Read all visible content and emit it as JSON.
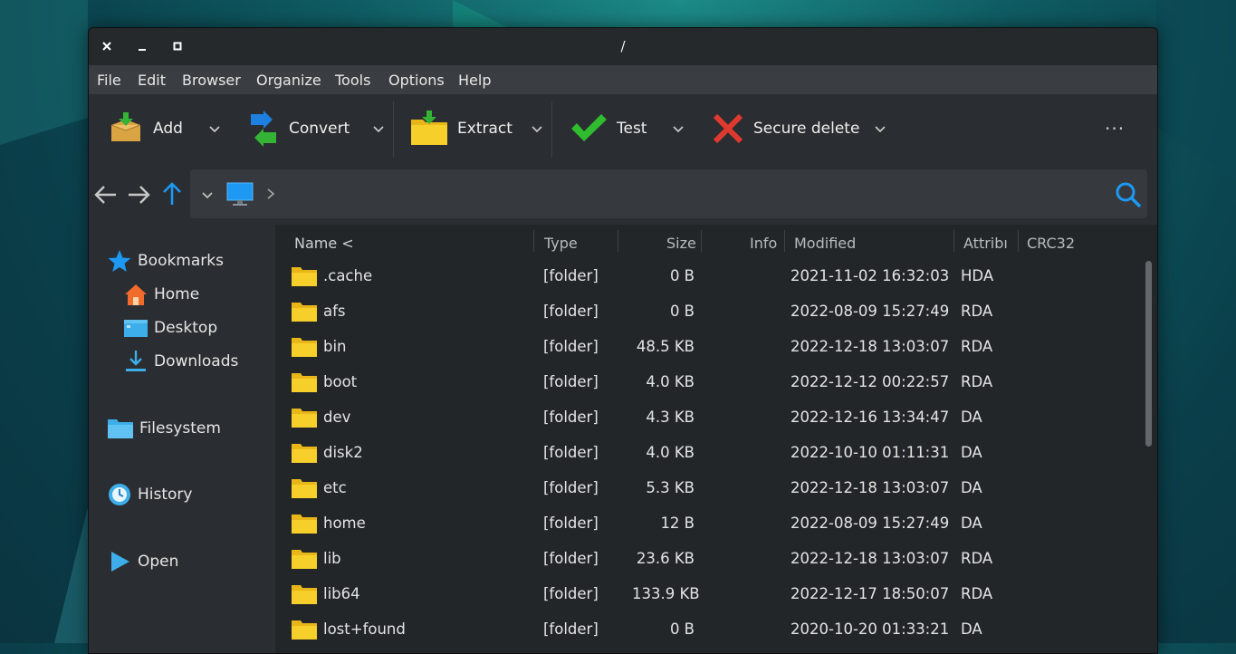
{
  "window": {
    "title": "/"
  },
  "titlebar": {
    "close": "×",
    "minimize": "–",
    "maximize": "▫"
  },
  "menu": [
    "File",
    "Edit",
    "Browser",
    "Organize",
    "Tools",
    "Options",
    "Help"
  ],
  "toolbar": {
    "add": "Add",
    "convert": "Convert",
    "extract": "Extract",
    "test": "Test",
    "secure_delete": "Secure delete",
    "more": "···"
  },
  "sidebar": {
    "bookmarks": "Bookmarks",
    "home": "Home",
    "desktop": "Desktop",
    "downloads": "Downloads",
    "filesystem": "Filesystem",
    "history": "History",
    "open": "Open"
  },
  "columns": {
    "name": "Name <",
    "type": "Type",
    "size": "Size",
    "info": "Info",
    "modified": "Modified",
    "attrib": "Attribı",
    "crc": "CRC32"
  },
  "files": [
    {
      "name": ".cache",
      "type": "[folder]",
      "size": "0 B",
      "modified": "2021-11-02 16:32:03",
      "attrib": "HDA"
    },
    {
      "name": "afs",
      "type": "[folder]",
      "size": "0 B",
      "modified": "2022-08-09 15:27:49",
      "attrib": "RDA"
    },
    {
      "name": "bin",
      "type": "[folder]",
      "size": "48.5 KB",
      "modified": "2022-12-18 13:03:07",
      "attrib": "RDA"
    },
    {
      "name": "boot",
      "type": "[folder]",
      "size": "4.0 KB",
      "modified": "2022-12-12 00:22:57",
      "attrib": "RDA"
    },
    {
      "name": "dev",
      "type": "[folder]",
      "size": "4.3 KB",
      "modified": "2022-12-16 13:34:47",
      "attrib": "DA"
    },
    {
      "name": "disk2",
      "type": "[folder]",
      "size": "4.0 KB",
      "modified": "2022-10-10 01:11:31",
      "attrib": "DA"
    },
    {
      "name": "etc",
      "type": "[folder]",
      "size": "5.3 KB",
      "modified": "2022-12-18 13:03:07",
      "attrib": "DA"
    },
    {
      "name": "home",
      "type": "[folder]",
      "size": "12 B",
      "modified": "2022-08-09 15:27:49",
      "attrib": "DA"
    },
    {
      "name": "lib",
      "type": "[folder]",
      "size": "23.6 KB",
      "modified": "2022-12-18 13:03:07",
      "attrib": "RDA"
    },
    {
      "name": "lib64",
      "type": "[folder]",
      "size": "133.9 KB",
      "modified": "2022-12-17 18:50:07",
      "attrib": "RDA"
    },
    {
      "name": "lost+found",
      "type": "[folder]",
      "size": "0 B",
      "modified": "2020-10-20 01:33:21",
      "attrib": "DA"
    }
  ],
  "colors": {
    "accent": "#1d99f3",
    "folder": "#f6c81d",
    "check": "#2fbd2f",
    "delete": "#e03a2f"
  }
}
